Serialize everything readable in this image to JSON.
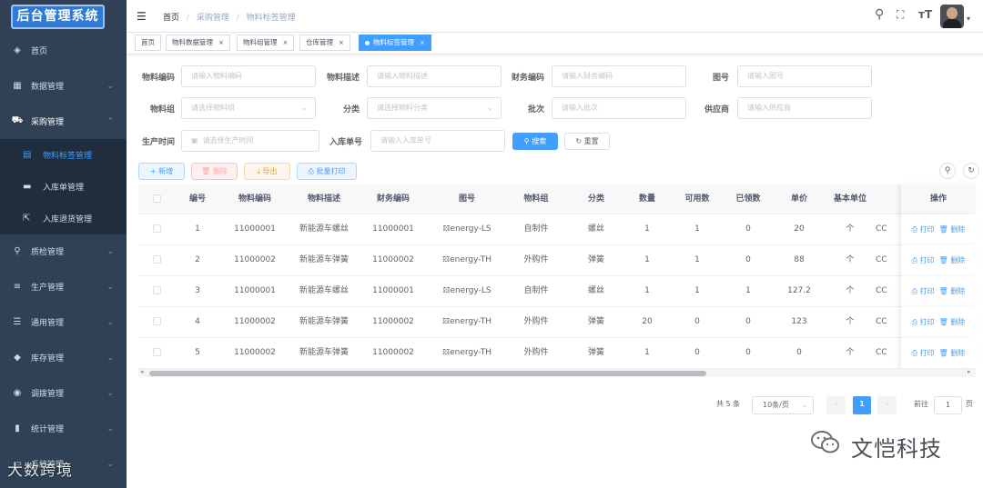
{
  "app": {
    "title": "后台管理系统"
  },
  "sidebar": {
    "items": [
      {
        "label": "首页",
        "icon": "dashboard-icon",
        "glyph": "◈"
      },
      {
        "label": "数据管理",
        "icon": "table-icon",
        "glyph": "▦"
      },
      {
        "label": "采购管理",
        "icon": "cart-icon",
        "glyph": "⛟"
      },
      {
        "label": "质检管理",
        "icon": "search-icon",
        "glyph": "⚲"
      },
      {
        "label": "生产管理",
        "icon": "sliders-icon",
        "glyph": "≡"
      },
      {
        "label": "通用管理",
        "icon": "list-icon",
        "glyph": "☰"
      },
      {
        "label": "库存管理",
        "icon": "cube-icon",
        "glyph": "◆"
      },
      {
        "label": "调拨管理",
        "icon": "target-icon",
        "glyph": "◉"
      },
      {
        "label": "统计管理",
        "icon": "bar-chart-icon",
        "glyph": "▮"
      },
      {
        "label": "系统管理",
        "icon": "monitor-icon",
        "glyph": "▭"
      }
    ],
    "sub_items": [
      {
        "label": "物料标签管理",
        "icon": "label-icon",
        "glyph": "▤"
      },
      {
        "label": "入库单管理",
        "icon": "folder-icon",
        "glyph": "▬"
      },
      {
        "label": "入库退货管理",
        "icon": "share-icon",
        "glyph": "⇱"
      }
    ]
  },
  "header": {
    "breadcrumb": [
      "首页",
      "采购管理",
      "物料标签管理"
    ],
    "separator": "/"
  },
  "tabs": [
    {
      "label": "首页"
    },
    {
      "label": "物料数据管理"
    },
    {
      "label": "物料组管理"
    },
    {
      "label": "仓库管理"
    },
    {
      "label": "物料标签管理"
    }
  ],
  "filters": {
    "material_code": {
      "label": "物料编码",
      "placeholder": "请输入物料编码"
    },
    "material_desc": {
      "label": "物料描述",
      "placeholder": "请输入物料描述"
    },
    "finance_code": {
      "label": "财务编码",
      "placeholder": "请输入财务编码"
    },
    "drawing_no": {
      "label": "图号",
      "placeholder": "请输入图号"
    },
    "material_group": {
      "label": "物料组",
      "placeholder": "请选择物料组"
    },
    "category": {
      "label": "分类",
      "placeholder": "请选择物料分类"
    },
    "batch": {
      "label": "批次",
      "placeholder": "请输入批次"
    },
    "supplier": {
      "label": "供应商",
      "placeholder": "请输入供应商"
    },
    "production_time": {
      "label": "生产时间",
      "placeholder": "请选择生产时间"
    },
    "inbound_no": {
      "label": "入库单号",
      "placeholder": "请输入入库单号"
    },
    "search_label": "搜索",
    "reset_label": "重置"
  },
  "toolbar": {
    "add_label": "新增",
    "delete_label": "删除",
    "export_label": "导出",
    "batch_print_label": "批量打印"
  },
  "table": {
    "columns": [
      "编号",
      "物料编码",
      "物料描述",
      "财务编码",
      "图号",
      "物料组",
      "分类",
      "数量",
      "可用数",
      "已领数",
      "单价",
      "基本单位",
      "",
      "操作"
    ],
    "rows": [
      [
        "1",
        "11000001",
        "新能源车螺丝",
        "11000001",
        "𝌸energy-LS",
        "自制件",
        "螺丝",
        "1",
        "1",
        "0",
        "20",
        "个",
        "CC"
      ],
      [
        "2",
        "11000002",
        "新能源车弹簧",
        "11000002",
        "𝌸energy-TH",
        "外购件",
        "弹簧",
        "1",
        "1",
        "0",
        "88",
        "个",
        "CC"
      ],
      [
        "3",
        "11000001",
        "新能源车螺丝",
        "11000001",
        "𝌸energy-LS",
        "自制件",
        "螺丝",
        "1",
        "1",
        "1",
        "127.2",
        "个",
        "CC"
      ],
      [
        "4",
        "11000002",
        "新能源车弹簧",
        "11000002",
        "𝌸energy-TH",
        "外购件",
        "弹簧",
        "20",
        "0",
        "0",
        "123",
        "个",
        "CC"
      ],
      [
        "5",
        "11000002",
        "新能源车弹簧",
        "11000002",
        "𝌸energy-TH",
        "外购件",
        "弹簧",
        "1",
        "0",
        "0",
        "0",
        "个",
        "CC"
      ]
    ],
    "print_label": "打印",
    "delete_label": "删除"
  },
  "pagination": {
    "total_text": "共 5 条",
    "page_size": "10条/页",
    "current_page": "1",
    "goto_label": "前往",
    "goto_value": "1",
    "page_suffix": "页"
  },
  "watermark": {
    "left": "大数跨境",
    "right": "文恺科技"
  },
  "colors": {
    "primary": "#409eff",
    "sidebar": "#304156",
    "danger": "#f56c6c",
    "warning": "#e6a23c"
  }
}
